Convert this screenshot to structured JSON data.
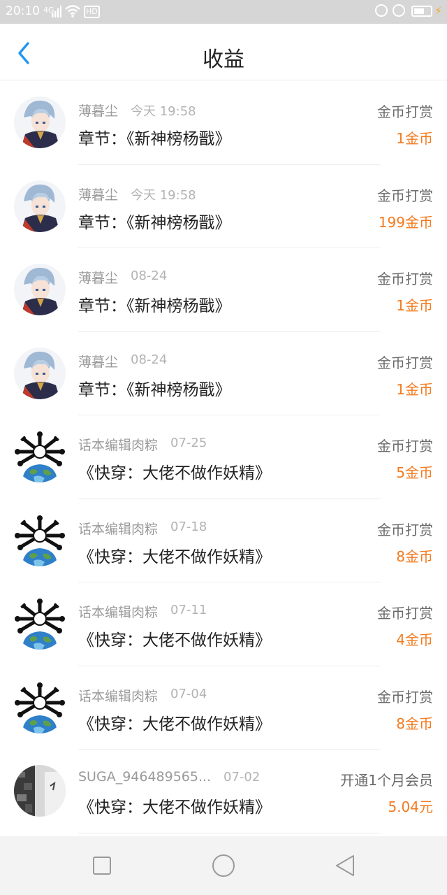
{
  "status_bar": {
    "time": "20:10",
    "signal_label": "4G",
    "hd_label": "HD"
  },
  "header": {
    "title": "收益",
    "back_icon": "chevron-left-icon"
  },
  "accent_color": "#f47a1f",
  "items": [
    {
      "name": "薄暮尘",
      "date": "今天 19:58",
      "work": "章节：《新神榜杨戬》",
      "type": "金币打赏",
      "amount": "1金币",
      "avatar": "anime-boy"
    },
    {
      "name": "薄暮尘",
      "date": "今天 19:58",
      "work": "章节：《新神榜杨戬》",
      "type": "金币打赏",
      "amount": "199金币",
      "avatar": "anime-boy"
    },
    {
      "name": "薄暮尘",
      "date": "08-24",
      "work": "章节：《新神榜杨戬》",
      "type": "金币打赏",
      "amount": "1金币",
      "avatar": "anime-boy"
    },
    {
      "name": "薄暮尘",
      "date": "08-24",
      "work": "章节：《新神榜杨戬》",
      "type": "金币打赏",
      "amount": "1金币",
      "avatar": "anime-boy"
    },
    {
      "name": "话本编辑肉粽",
      "date": "07-25",
      "work": "《快穿：大佬不做作妖精》",
      "type": "金币打赏",
      "amount": "5金币",
      "avatar": "globe-bones"
    },
    {
      "name": "话本编辑肉粽",
      "date": "07-18",
      "work": "《快穿：大佬不做作妖精》",
      "type": "金币打赏",
      "amount": "8金币",
      "avatar": "globe-bones"
    },
    {
      "name": "话本编辑肉粽",
      "date": "07-11",
      "work": "《快穿：大佬不做作妖精》",
      "type": "金币打赏",
      "amount": "4金币",
      "avatar": "globe-bones"
    },
    {
      "name": "话本编辑肉粽",
      "date": "07-04",
      "work": "《快穿：大佬不做作妖精》",
      "type": "金币打赏",
      "amount": "8金币",
      "avatar": "globe-bones"
    },
    {
      "name": "SUGA_946489565...",
      "date": "07-02",
      "work": "《快穿：大佬不做作妖精》",
      "type": "开通1个月会员",
      "amount": "5.04元",
      "avatar": "photo"
    }
  ],
  "nav": {
    "recents_icon": "square-icon",
    "home_icon": "circle-icon",
    "back_icon": "triangle-back-icon"
  }
}
